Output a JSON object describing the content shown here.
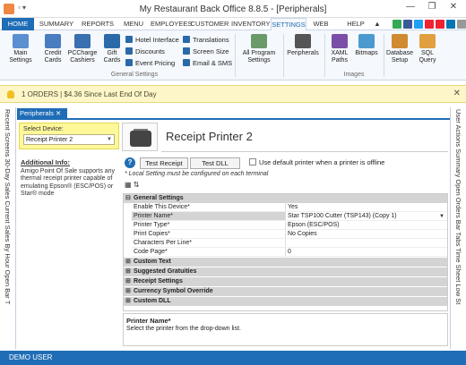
{
  "window": {
    "title": "My Restaurant Back Office  8.8.5 - [Peripherals]",
    "minimize": "—",
    "restore": "❐",
    "close": "✕"
  },
  "menu": {
    "tabs": [
      "HOME",
      "SUMMARY",
      "REPORTS",
      "MENU",
      "EMPLOYEES",
      "CUSTOMER",
      "INVENTORY",
      "SETTINGS",
      "WEB",
      "HELP"
    ],
    "active": "SETTINGS",
    "overflow": "▲"
  },
  "ribbon": {
    "main_settings": "Main Settings",
    "credit_cards": "Credit Cards",
    "pccharge": "PCCharge Cashiers",
    "gift_cards": "Gift Cards",
    "hotel_interface": "Hotel Interface",
    "discounts": "Discounts",
    "event_pricing": "Event Pricing",
    "translations": "Translations",
    "screen_size": "Screen Size",
    "email_sms": "Email & SMS",
    "general_settings_group": "General Settings",
    "all_program_settings": "All Program Settings",
    "peripherals": "Peripherals",
    "xaml_paths": "XAML Paths",
    "bitmaps": "Bitmaps",
    "images_group": "Images",
    "database_setup": "Database Setup",
    "sql_query": "SQL Query"
  },
  "alert": {
    "text": "1 ORDERS | $4.36 Since Last End Of Day",
    "close": "✕"
  },
  "left_rail": {
    "text": "Recent Screens   30-Day Sales   Current Sales By Hour   Open Bar T"
  },
  "right_rail": {
    "text": "User Actions   Summary   Open Orders   Bar Tabs   Time Sheet   Low St"
  },
  "doc_tab": {
    "label": "Peripherals",
    "close": "✕"
  },
  "device": {
    "label": "Select Device:",
    "value": "Receipt Printer 2"
  },
  "info": {
    "title": "Additional Info:",
    "text": "Amigo Point Of Sale supports any thermal receipt printer capable of emulating Epson® (ESC/POS) or Star® mode"
  },
  "heading": "Receipt Printer 2",
  "buttons": {
    "help": "?",
    "test_receipt": "Test Receipt",
    "test_dll": "Test DLL"
  },
  "default_printer_label": "Use default printer when a printer is offline",
  "note": "* Local Setting must be configured on each terminal",
  "grid": {
    "general_settings": "General Settings",
    "rows": [
      {
        "k": "Enable This Device*",
        "v": "Yes"
      },
      {
        "k": "Printer Name*",
        "v": "Star TSP100 Cutter (TSP143) (Copy 1)"
      },
      {
        "k": "Printer Type*",
        "v": "Epson (ESC/POS)"
      },
      {
        "k": "Print Copies*",
        "v": "No Copies"
      },
      {
        "k": "Characters Per Line*",
        "v": ""
      },
      {
        "k": "Code Page*",
        "v": "0"
      }
    ],
    "categories": [
      "Custom Text",
      "Suggested Gratuities",
      "Receipt Settings",
      "Currency Symbol Override",
      "Custom DLL"
    ]
  },
  "description": {
    "title": "Printer Name*",
    "text": "Select the printer from the drop-down list."
  },
  "status": "DEMO USER"
}
